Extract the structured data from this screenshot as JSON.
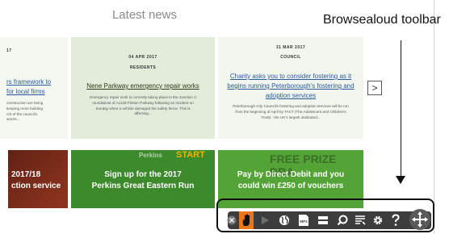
{
  "section": {
    "title": "Latest news"
  },
  "annotation": {
    "caption": "Browsealoud toolbar"
  },
  "cards": [
    {
      "date": "17",
      "headline": "rs framework to\nfor local firms",
      "summary": "construction are being\nkeeping more building\nrch of the council's\nactors..."
    },
    {
      "date": "04 APR 2017",
      "category": "RESIDENTS",
      "headline": "Nene Parkway emergency repair works",
      "summary": "Emergency repair work is currently taking place to the Junction 3 roundabout of A1139 Fletton Parkway following an incident on Sunday when a vehicle damaged the safety fence. This is affecting..."
    },
    {
      "date": "31 MAR 2017",
      "category": "COUNCIL",
      "headline": "Charity asks you to consider fostering as it begins running Peterborough's fostering and adoption services",
      "summary": "Peterborough City Council's fostering and adoption services will be run from the beginning of April by TACT (The Adolescent and Children's Trust) - the UK's largest dedicated..."
    }
  ],
  "carousel": {
    "next_label": ">"
  },
  "banners": [
    {
      "text": "2017/18\nction service"
    },
    {
      "text": "Sign up for the 2017\nPerkins Great Eastern Run",
      "brand": "Perkins",
      "badge": "START"
    },
    {
      "text": "Pay by Direct Debit and you\ncould win £250 of vouchers",
      "badge": "FREE PRIZE DRA"
    }
  ],
  "toolbar": {
    "buttons": [
      {
        "name": "close-icon"
      },
      {
        "name": "hover-speech-icon"
      },
      {
        "name": "play-icon"
      },
      {
        "name": "translate-globe-icon"
      },
      {
        "name": "mp3-icon"
      },
      {
        "name": "screen-mask-icon"
      },
      {
        "name": "magnifier-icon"
      },
      {
        "name": "simplify-page-icon"
      },
      {
        "name": "settings-icon"
      },
      {
        "name": "help-icon"
      },
      {
        "name": "move-handle-icon"
      }
    ],
    "mp3_label": "MP3",
    "accent": "#e8761a"
  }
}
